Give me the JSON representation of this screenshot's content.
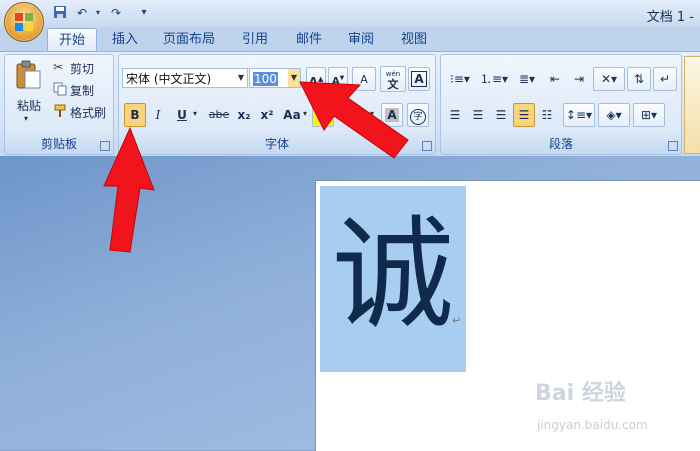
{
  "window": {
    "title": "文档 1 -"
  },
  "quick_access": [
    "save-icon",
    "undo-icon",
    "redo-icon",
    "customize-icon"
  ],
  "tabs": [
    {
      "label": "开始",
      "active": true
    },
    {
      "label": "插入"
    },
    {
      "label": "页面布局"
    },
    {
      "label": "引用"
    },
    {
      "label": "邮件"
    },
    {
      "label": "审阅"
    },
    {
      "label": "视图"
    }
  ],
  "clipboard": {
    "group_label": "剪贴板",
    "paste_label": "粘贴",
    "cut_label": "剪切",
    "copy_label": "复制",
    "format_painter_label": "格式刷"
  },
  "font": {
    "group_label": "字体",
    "font_name": "宋体 (中文正文)",
    "font_size": "100",
    "bold_label": "B",
    "italic_label": "I",
    "underline_label": "U",
    "strike_label": "abe",
    "subscript_label": "x₂",
    "superscript_label": "x²",
    "change_case_label": "Aa",
    "clear_format_glyph": "A",
    "phonetic_label": "wén",
    "phonetic_char": "文",
    "border_char": "A",
    "enclose_char": "字"
  },
  "paragraph": {
    "group_label": "段落"
  },
  "document": {
    "selected_text": "诚",
    "paragraph_mark": "↵"
  },
  "watermark": {
    "brand": "Bai 经验",
    "url": "jingyan.baidu.com"
  },
  "colors": {
    "arrow": "#f2141c",
    "selection": "#a7cdf0",
    "text": "#0f2a4a"
  }
}
